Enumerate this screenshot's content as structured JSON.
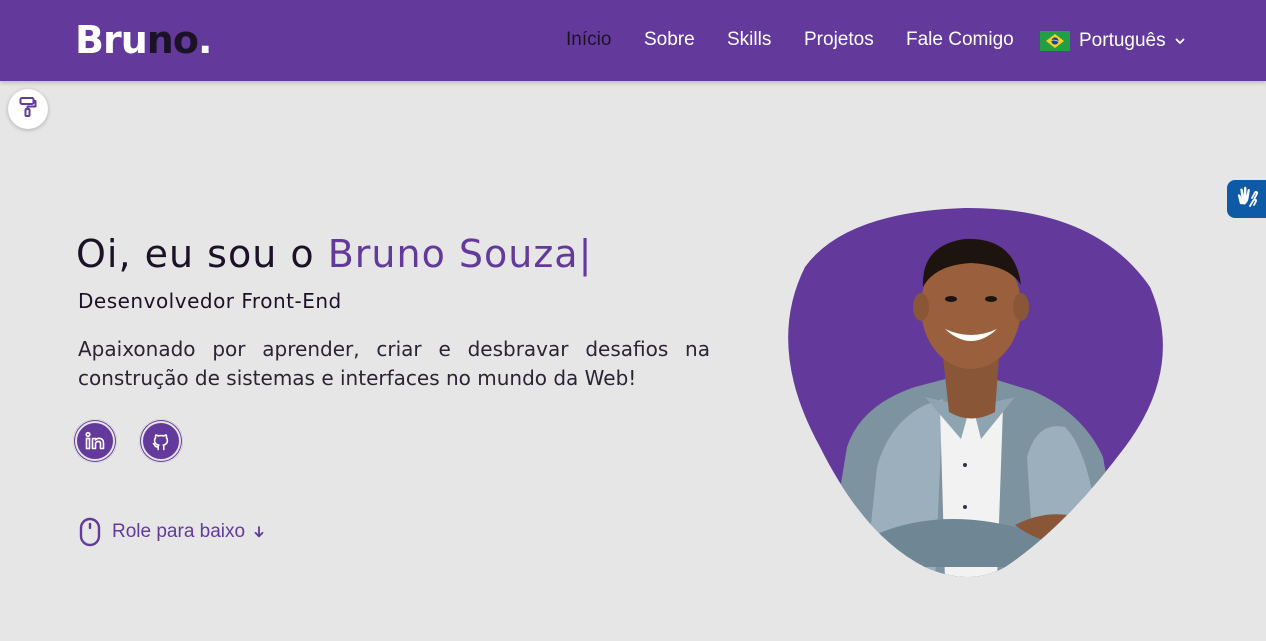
{
  "header": {
    "logo_first": "Bru",
    "logo_second": "no",
    "logo_dot": ".",
    "nav": [
      {
        "label": "Início",
        "active": true
      },
      {
        "label": "Sobre",
        "active": false
      },
      {
        "label": "Skills",
        "active": false
      },
      {
        "label": "Projetos",
        "active": false
      },
      {
        "label": "Fale Comigo",
        "active": false
      }
    ],
    "language": {
      "selected": "Português",
      "flag_icon": "brazil-flag-icon",
      "dropdown_icon": "chevron-down-icon"
    }
  },
  "tools": {
    "theme_icon": "paint-roller-icon",
    "accessibility_icon": "sign-language-hands-icon"
  },
  "hero": {
    "greeting": "Oi, eu sou o ",
    "name": "Bruno Souza",
    "caret": "|",
    "role": "Desenvolvedor Front-End",
    "description": "Apaixonado por aprender, criar e desbravar desafios na construção de sistemas e interfaces no mundo da Web!",
    "social": [
      {
        "icon": "linkedin-icon"
      },
      {
        "icon": "github-icon"
      }
    ],
    "scroll_label": "Role para baixo",
    "scroll_icon": "mouse-icon",
    "scroll_arrow_icon": "arrow-down-icon",
    "photo": "profile-photo"
  },
  "colors": {
    "primary": "#633a9c",
    "background": "#e6e6e6",
    "text_dark": "#1c1228",
    "white": "#ffffff",
    "vlibras_blue": "#0f5aa6"
  }
}
